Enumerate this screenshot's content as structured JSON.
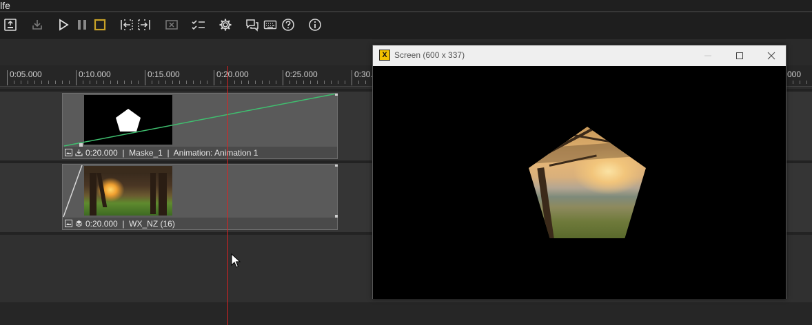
{
  "menu": {
    "help_label": "ilfe"
  },
  "toolbar": {
    "items": [
      {
        "name": "export-icon"
      },
      {
        "name": "publish-icon"
      },
      {
        "name": "play-icon"
      },
      {
        "name": "pause-icon"
      },
      {
        "name": "stop-icon"
      },
      {
        "name": "mark-in-icon"
      },
      {
        "name": "mark-out-icon"
      },
      {
        "name": "remove-icon"
      },
      {
        "name": "checklist-icon"
      },
      {
        "name": "settings-icon"
      },
      {
        "name": "comments-icon"
      },
      {
        "name": "keyboard-icon"
      },
      {
        "name": "help-icon"
      },
      {
        "name": "info-icon"
      }
    ],
    "accent_color": "#c9a227"
  },
  "ruler": {
    "labels": [
      "0:05.000",
      "0:10.000",
      "0:15.000",
      "0:20.000",
      "0:25.000",
      "0:30.",
      "000"
    ]
  },
  "tracks": [
    {
      "clip_label": "0:20.000  |  Maske_1  |  Animation: Animation 1",
      "icons": [
        "image-icon",
        "import-icon"
      ],
      "thumbnail": "white-pentagon-mask"
    },
    {
      "clip_label": "0:20.000  |  WX_NZ (16)",
      "icons": [
        "image-icon",
        "layers-icon"
      ],
      "thumbnail": "tree-sunset-photo"
    }
  ],
  "preview_window": {
    "app_icon_letter": "X",
    "title": "Screen (600 x 337)",
    "controls": [
      "minimize",
      "maximize",
      "close"
    ]
  },
  "colors": {
    "playhead": "#dd2222",
    "keyframe_line": "#3fbf6f",
    "stop_accent": "#c9a227"
  }
}
